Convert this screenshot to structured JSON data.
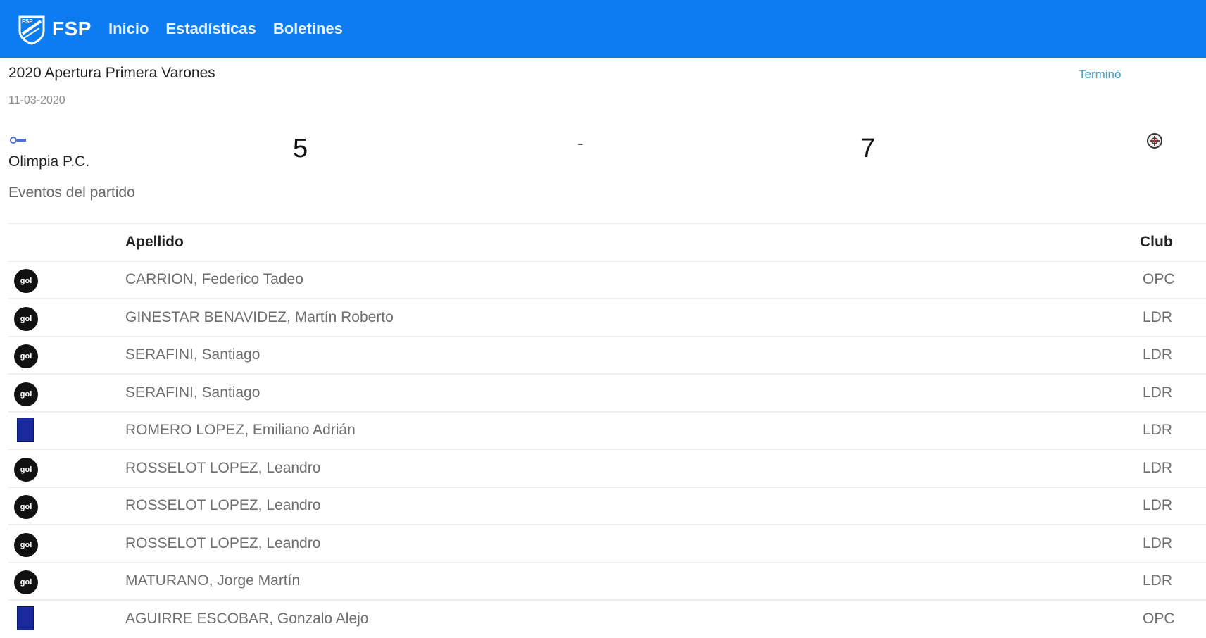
{
  "nav": {
    "logo_text": "FSP",
    "logo_badge": "FSP",
    "links": [
      "Inicio",
      "Estadísticas",
      "Boletines"
    ]
  },
  "match": {
    "title": "2020 Apertura Primera Varones",
    "status": "Terminó",
    "date": "11-03-2020",
    "home_team": "Olimpia P.C.",
    "home_score": "5",
    "separator": "-",
    "away_score": "7",
    "events_title": "Eventos del partido"
  },
  "table": {
    "headers": {
      "icon": "",
      "name": "Apellido",
      "club": "Club"
    },
    "rows": [
      {
        "icon": "gol-icon",
        "icon_text": "gol",
        "name": "CARRION, Federico Tadeo",
        "club": "OPC"
      },
      {
        "icon": "gol-icon",
        "icon_text": "gol",
        "name": "GINESTAR BENAVIDEZ, Martín Roberto",
        "club": "LDR"
      },
      {
        "icon": "gol-icon",
        "icon_text": "gol",
        "name": "SERAFINI, Santiago",
        "club": "LDR"
      },
      {
        "icon": "gol-icon",
        "icon_text": "gol",
        "name": "SERAFINI, Santiago",
        "club": "LDR"
      },
      {
        "icon": "blue-card-icon",
        "icon_text": "",
        "name": "ROMERO LOPEZ, Emiliano Adrián",
        "club": "LDR"
      },
      {
        "icon": "gol-icon",
        "icon_text": "gol",
        "name": "ROSSELOT LOPEZ, Leandro",
        "club": "LDR"
      },
      {
        "icon": "gol-icon",
        "icon_text": "gol",
        "name": "ROSSELOT LOPEZ, Leandro",
        "club": "LDR"
      },
      {
        "icon": "gol-icon",
        "icon_text": "gol",
        "name": "ROSSELOT LOPEZ, Leandro",
        "club": "LDR"
      },
      {
        "icon": "gol-icon",
        "icon_text": "gol",
        "name": "MATURANO, Jorge Martín",
        "club": "LDR"
      },
      {
        "icon": "blue-card-icon",
        "icon_text": "",
        "name": "AGUIRRE ESCOBAR, Gonzalo Alejo",
        "club": "OPC"
      }
    ]
  },
  "colors": {
    "navbar": "#0d7cf2",
    "status": "#3aa0c8",
    "blue_card": "#1a2a9c"
  }
}
